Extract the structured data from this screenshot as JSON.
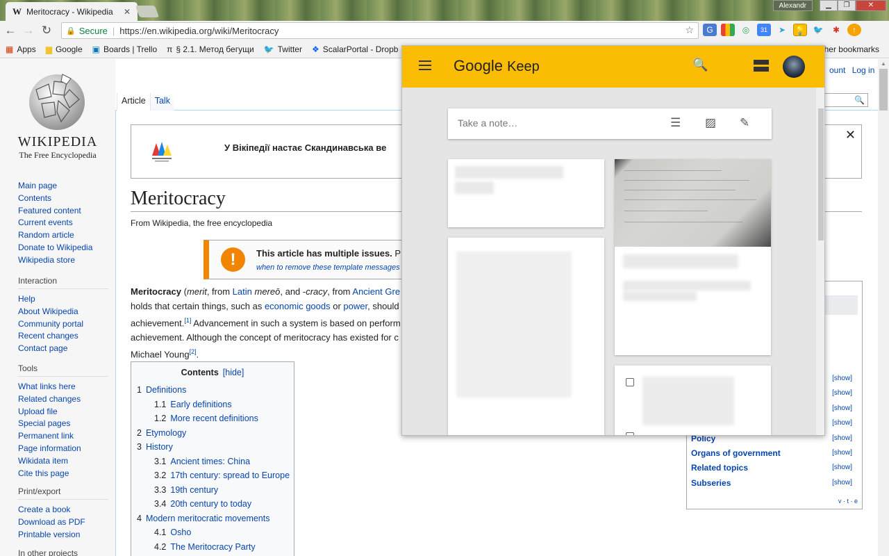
{
  "browser": {
    "tab_title": "Meritocracy - Wikipedia",
    "tab_favicon": "W",
    "profile_name": "Alexandr",
    "secure_label": "Secure",
    "url": "https://en.wikipedia.org/wiki/Meritocracy",
    "bookmarks": [
      {
        "label": "Apps",
        "icon": "apps-grid-icon",
        "glyph": "▦",
        "color": "#d83b01"
      },
      {
        "label": "Google",
        "icon": "folder-icon",
        "glyph": "▆",
        "color": "#f4c430"
      },
      {
        "label": "Boards | Trello",
        "icon": "trello-icon",
        "glyph": "▣",
        "color": "#0079bf"
      },
      {
        "label": "§ 2.1. Метод бегущи",
        "icon": "pi-icon",
        "glyph": "π",
        "color": "#222222"
      },
      {
        "label": "Twitter",
        "icon": "twitter-icon",
        "glyph": "🐦",
        "color": "#1da1f2"
      },
      {
        "label": "ScalarPortal - Dropb",
        "icon": "dropbox-icon",
        "glyph": "❖",
        "color": "#0061ff"
      }
    ],
    "other_bookmarks": "ther bookmarks"
  },
  "wiki": {
    "wordmark": "WIKIPEDIA",
    "tagline": "The Free Encyclopedia",
    "nav_links": [
      "Main page",
      "Contents",
      "Featured content",
      "Current events",
      "Random article",
      "Donate to Wikipedia",
      "Wikipedia store"
    ],
    "interaction_heading": "Interaction",
    "interaction_links": [
      "Help",
      "About Wikipedia",
      "Community portal",
      "Recent changes",
      "Contact page"
    ],
    "tools_heading": "Tools",
    "tools_links": [
      "What links here",
      "Related changes",
      "Upload file",
      "Special pages",
      "Permanent link",
      "Page information",
      "Wikidata item",
      "Cite this page"
    ],
    "print_heading": "Print/export",
    "print_links": [
      "Create a book",
      "Download as PDF",
      "Printable version"
    ],
    "other_heading": "In other projects",
    "tab_article": "Article",
    "tab_talk": "Talk",
    "personal_account": "ount",
    "personal_login": "Log in",
    "banner_text": "У Вікіпедії настає Скандинавська ве",
    "title": "Meritocracy",
    "subtitle": "From Wikipedia, the free encyclopedia",
    "issues_title": "This article has multiple issues.",
    "issues_title_tail": " P",
    "issues_link": "when to remove these template messages",
    "para": {
      "bold": "Meritocracy",
      "l1_a": " (",
      "l1_b": "merit",
      "l1_c": ", from ",
      "l1_latin": "Latin",
      "l1_d": " ",
      "l1_mereo": "mereō",
      "l1_e": ", and -",
      "l1_cracy": "cracy",
      "l1_f": ", from ",
      "l1_ancient": "Ancient Gre",
      "l2_a": "holds that certain things, such as ",
      "l2_econ": "economic goods",
      "l2_b": " or ",
      "l2_power": "power",
      "l2_c": ", should",
      "l3_a": "achievement.",
      "l3_ref": "[1]",
      "l3_b": " Advancement in such a system is based on perform",
      "l4": "achievement. Although the concept of meritocracy has existed for c",
      "l5_a": "Michael Young",
      "l5_ref": "[2]",
      "l5_b": "."
    },
    "toc_title": "Contents",
    "toc_hide": "[hide]",
    "toc": [
      {
        "n": "1",
        "t": "Definitions",
        "level": 1
      },
      {
        "n": "1.1",
        "t": "Early definitions",
        "level": 2
      },
      {
        "n": "1.2",
        "t": "More recent definitions",
        "level": 2
      },
      {
        "n": "2",
        "t": "Etymology",
        "level": 1
      },
      {
        "n": "3",
        "t": "History",
        "level": 1
      },
      {
        "n": "3.1",
        "t": "Ancient times: China",
        "level": 2
      },
      {
        "n": "3.2",
        "t": "17th century: spread to Europe",
        "level": 2
      },
      {
        "n": "3.3",
        "t": "19th century",
        "level": 2
      },
      {
        "n": "3.4",
        "t": "20th century to today",
        "level": 2
      },
      {
        "n": "4",
        "t": "Modern meritocratic movements",
        "level": 1
      },
      {
        "n": "4.1",
        "t": "Osho",
        "level": 2
      },
      {
        "n": "4.2",
        "t": "The Meritocracy Party",
        "level": 2
      }
    ],
    "navbox_rows": [
      {
        "label": "",
        "show": "[show]"
      },
      {
        "label": "",
        "show": "[show]"
      },
      {
        "label": "",
        "show": "[show]"
      },
      {
        "label": "",
        "show": "[show]"
      },
      {
        "label": "Policy",
        "show": "[show]"
      },
      {
        "label": "Organs of government",
        "show": "[show]"
      },
      {
        "label": "Related topics",
        "show": "[show]"
      },
      {
        "label": "Subseries",
        "show": "[show]"
      }
    ],
    "vte": "v · t · e"
  },
  "keep": {
    "logo_google": "Google",
    "logo_keep": "Keep",
    "take_note_placeholder": "Take a note…",
    "accent": "#fbbc04"
  }
}
